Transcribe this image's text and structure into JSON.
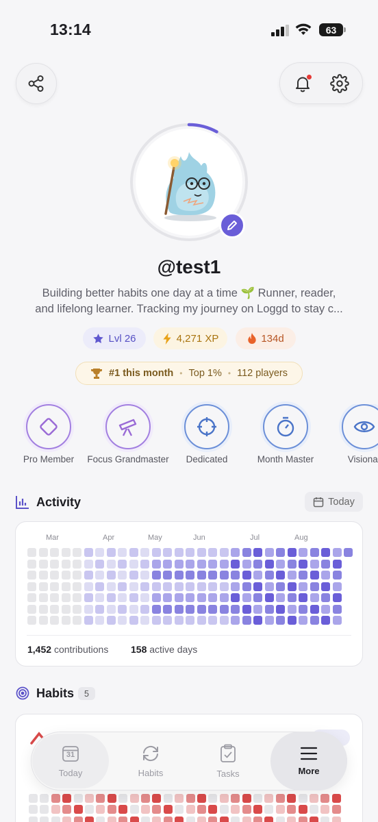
{
  "status": {
    "time": "13:14",
    "battery": "63"
  },
  "profile": {
    "username": "@test1",
    "bio_line1": "Building better habits one day at a time 🌱 Runner, reader,",
    "bio_line2": "and lifelong learner. Tracking my journey on Loggd to stay c...",
    "level_progress": 0.08
  },
  "stats": {
    "level": "Lvl 26",
    "xp": "4,271 XP",
    "streak": "134d"
  },
  "rank": {
    "position": "#1 this month",
    "percentile": "Top 1%",
    "players": "112 players"
  },
  "badges": [
    {
      "label": "Pro Member",
      "icon": "diamond-icon"
    },
    {
      "label": "Focus Grandmaster",
      "icon": "telescope-icon"
    },
    {
      "label": "Dedicated",
      "icon": "crosshair-icon"
    },
    {
      "label": "Month Master",
      "icon": "stopwatch-icon"
    },
    {
      "label": "Visionar",
      "icon": "eye-icon"
    }
  ],
  "activity": {
    "title": "Activity",
    "range_label": "Today",
    "months": [
      "Mar",
      "Apr",
      "May",
      "Jun",
      "Jul",
      "Aug"
    ],
    "contributions_count": "1,452",
    "contributions_label": "contributions",
    "active_days_count": "158",
    "active_days_label": "active days"
  },
  "habits": {
    "title": "Habits",
    "count": "5"
  },
  "tabs": [
    {
      "label": "Today",
      "icon": "calendar-icon",
      "date": "31"
    },
    {
      "label": "Habits",
      "icon": "refresh-icon"
    },
    {
      "label": "Tasks",
      "icon": "clipboard-icon"
    },
    {
      "label": "More",
      "icon": "menu-icon"
    }
  ],
  "colors": {
    "accent": "#6a5ed8",
    "badge_purple": "#9a6bd6",
    "badge_blue": "#4a74c8",
    "streak": "#e8622a",
    "xp": "#e8a21a",
    "habit_red": "#d94a4a",
    "notification": "#e53935"
  }
}
